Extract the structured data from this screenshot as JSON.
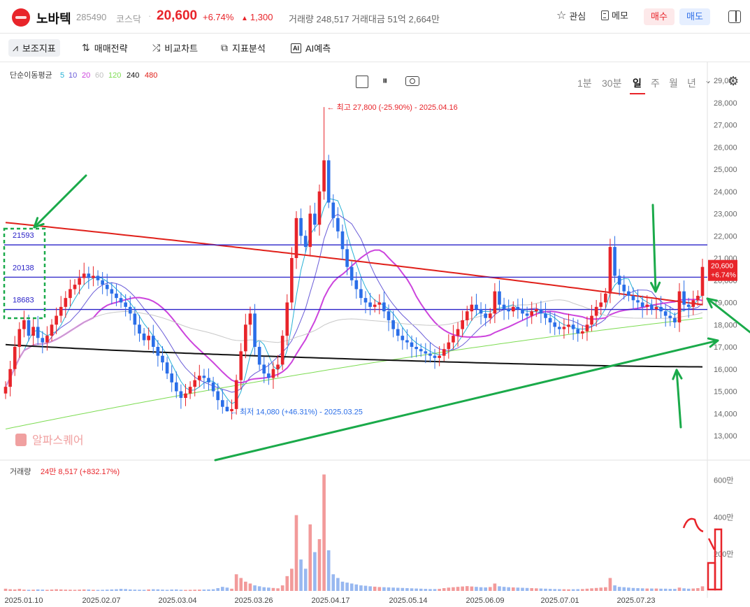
{
  "header": {
    "stock_name": "노바텍",
    "stock_code": "285490",
    "market": "코스닥",
    "price": "20,600",
    "change_pct": "+6.74%",
    "change_amt": "1,300",
    "volume_label": "거래량",
    "volume": "248,517",
    "amount_label": "거래대금",
    "amount": "51억 2,664만",
    "watch_label": "관심",
    "memo_label": "메모",
    "buy_label": "매수",
    "sell_label": "매도"
  },
  "toolbar": {
    "indicators": "보조지표",
    "strategy": "매매전략",
    "compare": "비교차트",
    "analysis": "지표분석",
    "ai": "AI예측",
    "ai_badge": "AI",
    "periods": [
      "1분",
      "30분",
      "일",
      "주",
      "월",
      "년"
    ],
    "selected_period": "일"
  },
  "colors": {
    "up": "#e8242a",
    "down": "#2a6ee8",
    "ma5": "#27b1d6",
    "ma10": "#6a5cd8",
    "ma20": "#cc44dd",
    "ma60": "#c8c8c8",
    "ma120": "#7ddc52",
    "ma240": "#111111",
    "ma480": "#e0201a",
    "annotation_green": "#1aaa4a",
    "hline": "#2a22c8"
  },
  "chart_data": {
    "type": "candlestick",
    "ma_legend": {
      "title": "단순이동평균",
      "periods": [
        "5",
        "10",
        "20",
        "60",
        "120",
        "240",
        "480"
      ]
    },
    "y_ticks": [
      "29,000",
      "28,000",
      "27,000",
      "26,000",
      "25,000",
      "24,000",
      "23,000",
      "22,000",
      "21,000",
      "20,000",
      "19,000",
      "18,000",
      "17,000",
      "16,000",
      "15,000",
      "14,000",
      "13,000"
    ],
    "ylim": [
      12400,
      29600
    ],
    "x_dates": [
      "2025.01.10",
      "2025.02.07",
      "2025.03.04",
      "2025.03.26",
      "2025.04.17",
      "2025.05.14",
      "2025.06.09",
      "2025.07.01",
      "2025.07.23"
    ],
    "candle_closes": [
      15200,
      16000,
      17000,
      17800,
      18200,
      17500,
      17900,
      17400,
      17200,
      17500,
      18000,
      18400,
      18800,
      19200,
      19600,
      19800,
      20100,
      20300,
      20100,
      20200,
      20000,
      19800,
      19600,
      19400,
      19200,
      19000,
      18800,
      18500,
      18000,
      17600,
      17300,
      17500,
      17000,
      16600,
      16300,
      15800,
      15400,
      15000,
      14700,
      14900,
      15200,
      15500,
      15700,
      15600,
      15400,
      15000,
      14600,
      14300,
      14100,
      14200,
      15500,
      16800,
      18000,
      18500,
      17000,
      16200,
      15800,
      15600,
      16000,
      16200,
      17500,
      19000,
      21000,
      22800,
      22000,
      21500,
      23000,
      22500,
      24000,
      25400,
      23500,
      22800,
      22200,
      21400,
      20600,
      20000,
      19600,
      19200,
      19000,
      18800,
      18900,
      19000,
      18600,
      18200,
      17800,
      17500,
      17300,
      17200,
      17000,
      16900,
      16800,
      16700,
      16600,
      16500,
      16600,
      16900,
      17200,
      17500,
      17800,
      18200,
      18600,
      18900,
      18700,
      18500,
      18300,
      18500,
      19500,
      18900,
      18700,
      18600,
      18800,
      18700,
      18500,
      18400,
      18600,
      18700,
      18500,
      18300,
      18100,
      17900,
      17800,
      17900,
      18000,
      17800,
      17600,
      17700,
      18000,
      18400,
      18800,
      19000,
      19400,
      21500,
      20200,
      19800,
      19500,
      19300,
      19100,
      19000,
      18800,
      18900,
      18700,
      18800,
      18600,
      18400,
      18300,
      18100,
      19500,
      18900,
      18800,
      19100,
      19300,
      20600
    ],
    "horizontal_levels": [
      21593,
      20138,
      18683
    ],
    "annotations": {
      "high": "최고 27,800 (-25.90%) - 2025.04.16",
      "low": "최저 14,080 (+46.31%) - 2025.03.25"
    },
    "last_price_label": "20,600",
    "last_pct_label": "+6.74%",
    "watermark": "알파스퀘어",
    "volume_panel": {
      "title": "거래량",
      "summary": "24만 8,517 (+832.17%)",
      "y_ticks": [
        "600만",
        "400만",
        "200만"
      ],
      "ylim": [
        0,
        7000000
      ],
      "values": [
        120000,
        90000,
        80000,
        110000,
        70000,
        60000,
        65000,
        80000,
        70000,
        60000,
        75000,
        90000,
        80000,
        70000,
        65000,
        60000,
        70000,
        80000,
        75000,
        60000,
        55000,
        60000,
        70000,
        80000,
        90000,
        110000,
        100000,
        80000,
        70000,
        65000,
        60000,
        80000,
        90000,
        85000,
        70000,
        60000,
        75000,
        80000,
        60000,
        55000,
        60000,
        65000,
        70000,
        75000,
        80000,
        90000,
        150000,
        220000,
        180000,
        120000,
        900000,
        700000,
        500000,
        400000,
        300000,
        250000,
        200000,
        180000,
        160000,
        140000,
        300000,
        800000,
        1200000,
        4100000,
        1700000,
        1200000,
        3600000,
        2100000,
        2800000,
        6300000,
        2200000,
        900000,
        700000,
        500000,
        450000,
        400000,
        350000,
        300000,
        280000,
        250000,
        230000,
        210000,
        200000,
        190000,
        180000,
        170000,
        160000,
        150000,
        140000,
        130000,
        120000,
        110000,
        100000,
        100000,
        110000,
        150000,
        180000,
        200000,
        220000,
        240000,
        260000,
        240000,
        220000,
        200000,
        190000,
        210000,
        400000,
        250000,
        220000,
        200000,
        190000,
        180000,
        170000,
        160000,
        150000,
        140000,
        130000,
        120000,
        110000,
        100000,
        95000,
        90000,
        85000,
        90000,
        95000,
        100000,
        120000,
        140000,
        160000,
        180000,
        200000,
        700000,
        300000,
        220000,
        200000,
        180000,
        160000,
        150000,
        140000,
        130000,
        130000,
        130000,
        120000,
        120000,
        110000,
        110000,
        180000,
        140000,
        120000,
        130000,
        150000,
        248517
      ]
    }
  }
}
